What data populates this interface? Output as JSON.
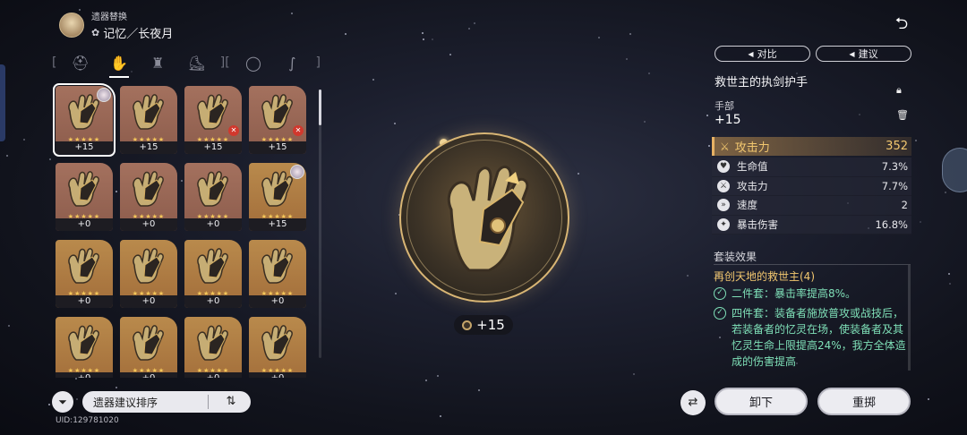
{
  "header": {
    "subtitle": "遗器替换",
    "path_icon": "path-icon",
    "title": "记忆／长夜月"
  },
  "categories": [
    {
      "name": "head",
      "icon": "helmet-icon",
      "active": false
    },
    {
      "name": "hands",
      "icon": "glove-icon",
      "active": true
    },
    {
      "name": "body",
      "icon": "armor-icon",
      "active": false
    },
    {
      "name": "feet",
      "icon": "boots-icon",
      "active": false
    },
    {
      "name": "sphere",
      "icon": "sphere-icon",
      "active": false
    },
    {
      "name": "rope",
      "icon": "rope-icon",
      "active": false
    }
  ],
  "relics": [
    {
      "level": "+15",
      "variant": "brown",
      "selected": true,
      "owner": true,
      "trash": false
    },
    {
      "level": "+15",
      "variant": "brown",
      "selected": false,
      "owner": false,
      "trash": false
    },
    {
      "level": "+15",
      "variant": "brown",
      "selected": false,
      "owner": false,
      "trash": true
    },
    {
      "level": "+15",
      "variant": "brown",
      "selected": false,
      "owner": false,
      "trash": true
    },
    {
      "level": "+0",
      "variant": "brown",
      "selected": false,
      "owner": false,
      "trash": false
    },
    {
      "level": "+0",
      "variant": "brown",
      "selected": false,
      "owner": false,
      "trash": false
    },
    {
      "level": "+0",
      "variant": "brown",
      "selected": false,
      "owner": false,
      "trash": false
    },
    {
      "level": "+15",
      "variant": "gold",
      "selected": false,
      "owner": true,
      "trash": false
    },
    {
      "level": "+0",
      "variant": "gold",
      "selected": false,
      "owner": false,
      "trash": false
    },
    {
      "level": "+0",
      "variant": "gold",
      "selected": false,
      "owner": false,
      "trash": false
    },
    {
      "level": "+0",
      "variant": "gold",
      "selected": false,
      "owner": false,
      "trash": false
    },
    {
      "level": "+0",
      "variant": "gold",
      "selected": false,
      "owner": false,
      "trash": false
    },
    {
      "level": "+0",
      "variant": "gold",
      "selected": false,
      "owner": false,
      "trash": false
    },
    {
      "level": "+0",
      "variant": "gold",
      "selected": false,
      "owner": false,
      "trash": false
    },
    {
      "level": "+0",
      "variant": "gold",
      "selected": false,
      "owner": false,
      "trash": false
    },
    {
      "level": "+0",
      "variant": "gold",
      "selected": false,
      "owner": false,
      "trash": false
    }
  ],
  "stars": "★★★★★",
  "sort": {
    "label": "遗器建议排序",
    "toggle_icon": "sort-order-icon"
  },
  "uid": "UID:129781020",
  "center": {
    "level": "+15"
  },
  "right": {
    "compare_label": "对比",
    "suggest_label": "建议",
    "relic_name": "救世主的执剑护手",
    "slot": "手部",
    "level": "+15",
    "main_stat": {
      "name": "攻击力",
      "value": "352",
      "icon": "sword-icon"
    },
    "sub_stats": [
      {
        "name": "生命值",
        "value": "7.3%",
        "icon": "heart-icon"
      },
      {
        "name": "攻击力",
        "value": "7.7%",
        "icon": "sword-icon"
      },
      {
        "name": "速度",
        "value": "2",
        "icon": "boot-speed-icon"
      },
      {
        "name": "暴击伤害",
        "value": "16.8%",
        "icon": "crit-icon"
      }
    ],
    "set_title": "套装效果",
    "set_name": "再创天地的救世主(4)",
    "set_effects": [
      "二件套：暴击率提高8%。",
      "四件套：装备者施放普攻或战技后，若装备者的忆灵在场，使装备者及其忆灵生命上限提高24%，我方全体造成的伤害提高"
    ],
    "unequip_label": "卸下",
    "reroll_label": "重掷"
  },
  "colors": {
    "accent_gold": "#f2c76f",
    "set_green": "#7fe0b8",
    "relic_brown": "#8c5c4c",
    "relic_gold": "#b98a4c"
  }
}
